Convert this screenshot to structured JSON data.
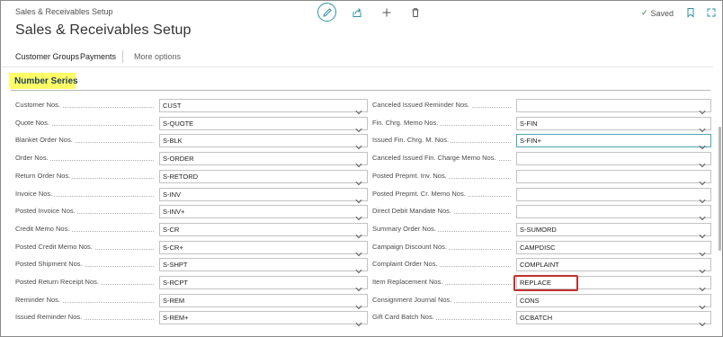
{
  "window": {
    "breadcrumb": "Sales & Receivables Setup",
    "saved_label": "Saved"
  },
  "page": {
    "title": "Sales & Receivables Setup"
  },
  "actions": {
    "customer_groups": "Customer Groups",
    "payments": "Payments",
    "more_options": "More options"
  },
  "section": {
    "title": "Number Series",
    "highlight_color": "#ffff66"
  },
  "left_fields": [
    {
      "label": "Customer Nos.",
      "value": "CUST"
    },
    {
      "label": "Quote Nos.",
      "value": "S-QUOTE"
    },
    {
      "label": "Blanket Order Nos.",
      "value": "S-BLK"
    },
    {
      "label": "Order Nos.",
      "value": "S-ORDER"
    },
    {
      "label": "Return Order Nos.",
      "value": "S-RETORD"
    },
    {
      "label": "Invoice Nos.",
      "value": "S-INV"
    },
    {
      "label": "Posted Invoice Nos.",
      "value": "S-INV+"
    },
    {
      "label": "Credit Memo Nos.",
      "value": "S-CR"
    },
    {
      "label": "Posted Credit Memo Nos.",
      "value": "S-CR+"
    },
    {
      "label": "Posted Shipment Nos.",
      "value": "S-SHPT"
    },
    {
      "label": "Posted Return Receipt Nos.",
      "value": "S-RCPT"
    },
    {
      "label": "Reminder Nos.",
      "value": "S-REM"
    },
    {
      "label": "Issued Reminder Nos.",
      "value": "S-REM+"
    }
  ],
  "right_fields": [
    {
      "label": "Canceled Issued Reminder Nos.",
      "value": ""
    },
    {
      "label": "Fin. Chrg. Memo Nos.",
      "value": "S-FIN"
    },
    {
      "label": "Issued Fin. Chrg. M. Nos.",
      "value": "S-FIN+"
    },
    {
      "label": "Canceled Issued Fin. Charge Memo Nos.",
      "value": ""
    },
    {
      "label": "Posted Prepmt. Inv. Nos.",
      "value": ""
    },
    {
      "label": "Posted Prepmt. Cr. Memo Nos.",
      "value": ""
    },
    {
      "label": "Direct Debit Mandate Nos.",
      "value": ""
    },
    {
      "label": "Summary Order Nos.",
      "value": "S-SUMORD"
    },
    {
      "label": "Campaign Discount Nos.",
      "value": "CAMPDISC"
    },
    {
      "label": "Complaint Order Nos.",
      "value": "COMPLAINT"
    },
    {
      "label": "Item Replacement Nos.",
      "value": "REPLACE"
    },
    {
      "label": "Consignment Journal Nos.",
      "value": "CONS"
    },
    {
      "label": "Gift Card Batch Nos.",
      "value": "GCBATCH"
    }
  ],
  "colors": {
    "accent": "#2d8fa1",
    "focus_border": "#4ea3b3",
    "callout_box": "#c0312f"
  },
  "icons": {
    "edit": "pencil-icon",
    "share": "share-icon",
    "new": "plus-icon",
    "delete": "trash-icon",
    "saved": "check-icon",
    "bookmark": "bookmark-icon",
    "expand": "expand-icon",
    "dropdown": "chevron-down-icon"
  }
}
